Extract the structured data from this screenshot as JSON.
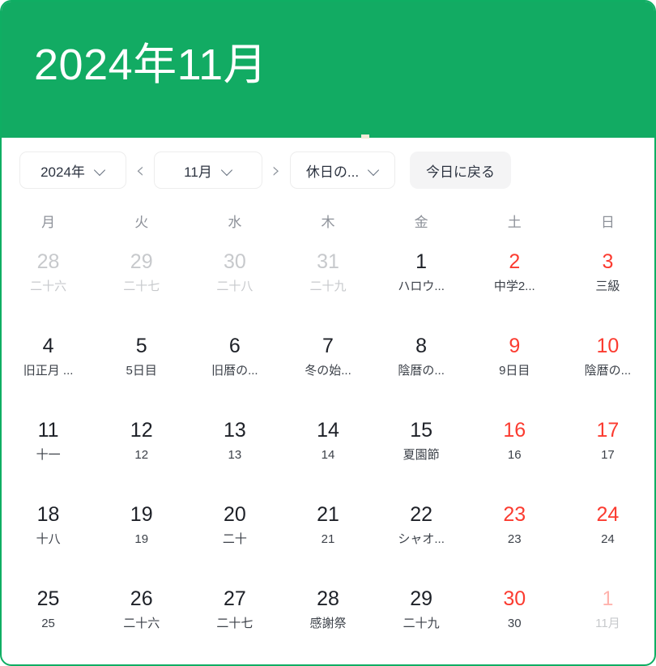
{
  "header": {
    "title": "2024年11月",
    "bg_color": "#12ab63"
  },
  "toolbar": {
    "year_select": "2024年",
    "prev_label": "‹",
    "month_select": "11月",
    "next_label": "›",
    "filter_select": "休日の...",
    "today_button": "今日に戻る"
  },
  "weekdays": [
    "月",
    "火",
    "水",
    "木",
    "金",
    "土",
    "日"
  ],
  "colors": {
    "accent": "#12ab63",
    "weekend": "#fb3b30",
    "outside": "#c7c9cc",
    "text": "#1d2027"
  },
  "weeks": [
    [
      {
        "day": "28",
        "sub": "二十六",
        "outside": true,
        "weekend": false
      },
      {
        "day": "29",
        "sub": "二十七",
        "outside": true,
        "weekend": false
      },
      {
        "day": "30",
        "sub": "二十八",
        "outside": true,
        "weekend": false
      },
      {
        "day": "31",
        "sub": "二十九",
        "outside": true,
        "weekend": false
      },
      {
        "day": "1",
        "sub": "ハロウ...",
        "outside": false,
        "weekend": false
      },
      {
        "day": "2",
        "sub": "中学2...",
        "outside": false,
        "weekend": true
      },
      {
        "day": "3",
        "sub": "三級",
        "outside": false,
        "weekend": true
      }
    ],
    [
      {
        "day": "4",
        "sub": "旧正月 ...",
        "outside": false,
        "weekend": false
      },
      {
        "day": "5",
        "sub": "5日目",
        "outside": false,
        "weekend": false
      },
      {
        "day": "6",
        "sub": "旧暦の...",
        "outside": false,
        "weekend": false
      },
      {
        "day": "7",
        "sub": "冬の始...",
        "outside": false,
        "weekend": false
      },
      {
        "day": "8",
        "sub": "陰暦の...",
        "outside": false,
        "weekend": false
      },
      {
        "day": "9",
        "sub": "9日目",
        "outside": false,
        "weekend": true
      },
      {
        "day": "10",
        "sub": "陰暦の...",
        "outside": false,
        "weekend": true
      }
    ],
    [
      {
        "day": "11",
        "sub": "十一",
        "outside": false,
        "weekend": false
      },
      {
        "day": "12",
        "sub": "12",
        "outside": false,
        "weekend": false
      },
      {
        "day": "13",
        "sub": "13",
        "outside": false,
        "weekend": false
      },
      {
        "day": "14",
        "sub": "14",
        "outside": false,
        "weekend": false
      },
      {
        "day": "15",
        "sub": "夏園節",
        "outside": false,
        "weekend": false
      },
      {
        "day": "16",
        "sub": "16",
        "outside": false,
        "weekend": true
      },
      {
        "day": "17",
        "sub": "17",
        "outside": false,
        "weekend": true
      }
    ],
    [
      {
        "day": "18",
        "sub": "十八",
        "outside": false,
        "weekend": false
      },
      {
        "day": "19",
        "sub": "19",
        "outside": false,
        "weekend": false
      },
      {
        "day": "20",
        "sub": "二十",
        "outside": false,
        "weekend": false
      },
      {
        "day": "21",
        "sub": "21",
        "outside": false,
        "weekend": false
      },
      {
        "day": "22",
        "sub": "シャオ...",
        "outside": false,
        "weekend": false
      },
      {
        "day": "23",
        "sub": "23",
        "outside": false,
        "weekend": true
      },
      {
        "day": "24",
        "sub": "24",
        "outside": false,
        "weekend": true
      }
    ],
    [
      {
        "day": "25",
        "sub": "25",
        "outside": false,
        "weekend": false
      },
      {
        "day": "26",
        "sub": "二十六",
        "outside": false,
        "weekend": false
      },
      {
        "day": "27",
        "sub": "二十七",
        "outside": false,
        "weekend": false
      },
      {
        "day": "28",
        "sub": "感謝祭",
        "outside": false,
        "weekend": false
      },
      {
        "day": "29",
        "sub": "二十九",
        "outside": false,
        "weekend": false
      },
      {
        "day": "30",
        "sub": "30",
        "outside": false,
        "weekend": true
      },
      {
        "day": "1",
        "sub": "11月",
        "outside": true,
        "weekend": true
      }
    ]
  ]
}
